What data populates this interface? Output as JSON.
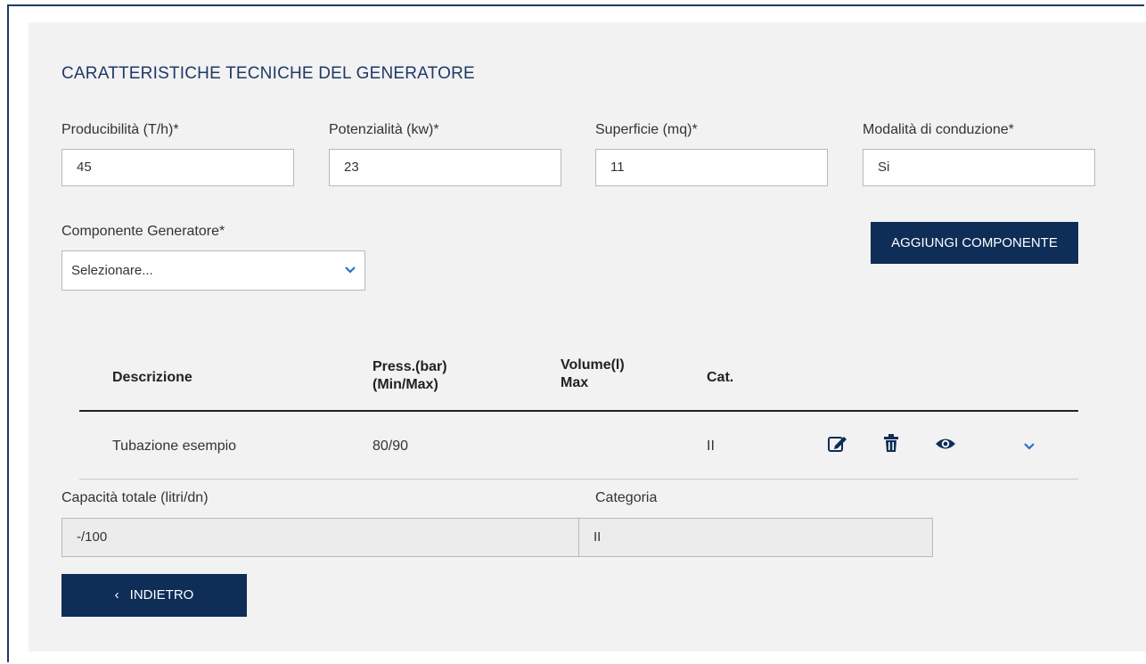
{
  "section": {
    "title": "CARATTERISTICHE TECNICHE DEL GENERATORE"
  },
  "fields": [
    {
      "label": "Producibilità (T/h)*",
      "value": "45"
    },
    {
      "label": "Potenzialità (kw)*",
      "value": "23"
    },
    {
      "label": "Superficie (mq)*",
      "value": "11"
    },
    {
      "label": "Modalità di conduzione*",
      "value": "Si"
    }
  ],
  "component": {
    "label": "Componente Generatore*",
    "selected": "Selezionare..."
  },
  "add_button": {
    "label": "AGGIUNGI COMPONENTE"
  },
  "table": {
    "headers": {
      "descrizione": "Descrizione",
      "press_line1": "Press.(bar)",
      "press_line2": "(Min/Max)",
      "volume_line1": "Volume(l)",
      "volume_line2": "Max",
      "cat": "Cat."
    },
    "rows": [
      {
        "descrizione": "Tubazione esempio",
        "press": "80/90",
        "volume": "",
        "cat": "II"
      }
    ]
  },
  "totals": {
    "capacity_label": "Capacità totale (litri/dn)",
    "capacity_value": "-/100",
    "category_label": "Categoria",
    "category_value": "II"
  },
  "back_button": {
    "chevron": "‹",
    "label": "INDIETRO"
  },
  "colors": {
    "primary": "#0e2d57",
    "title": "#1f3a66",
    "panel": "#f2f2f2",
    "accent": "#2a6fd1"
  },
  "icons": [
    "edit-icon",
    "trash-icon",
    "eye-icon",
    "chevron-down-icon"
  ]
}
